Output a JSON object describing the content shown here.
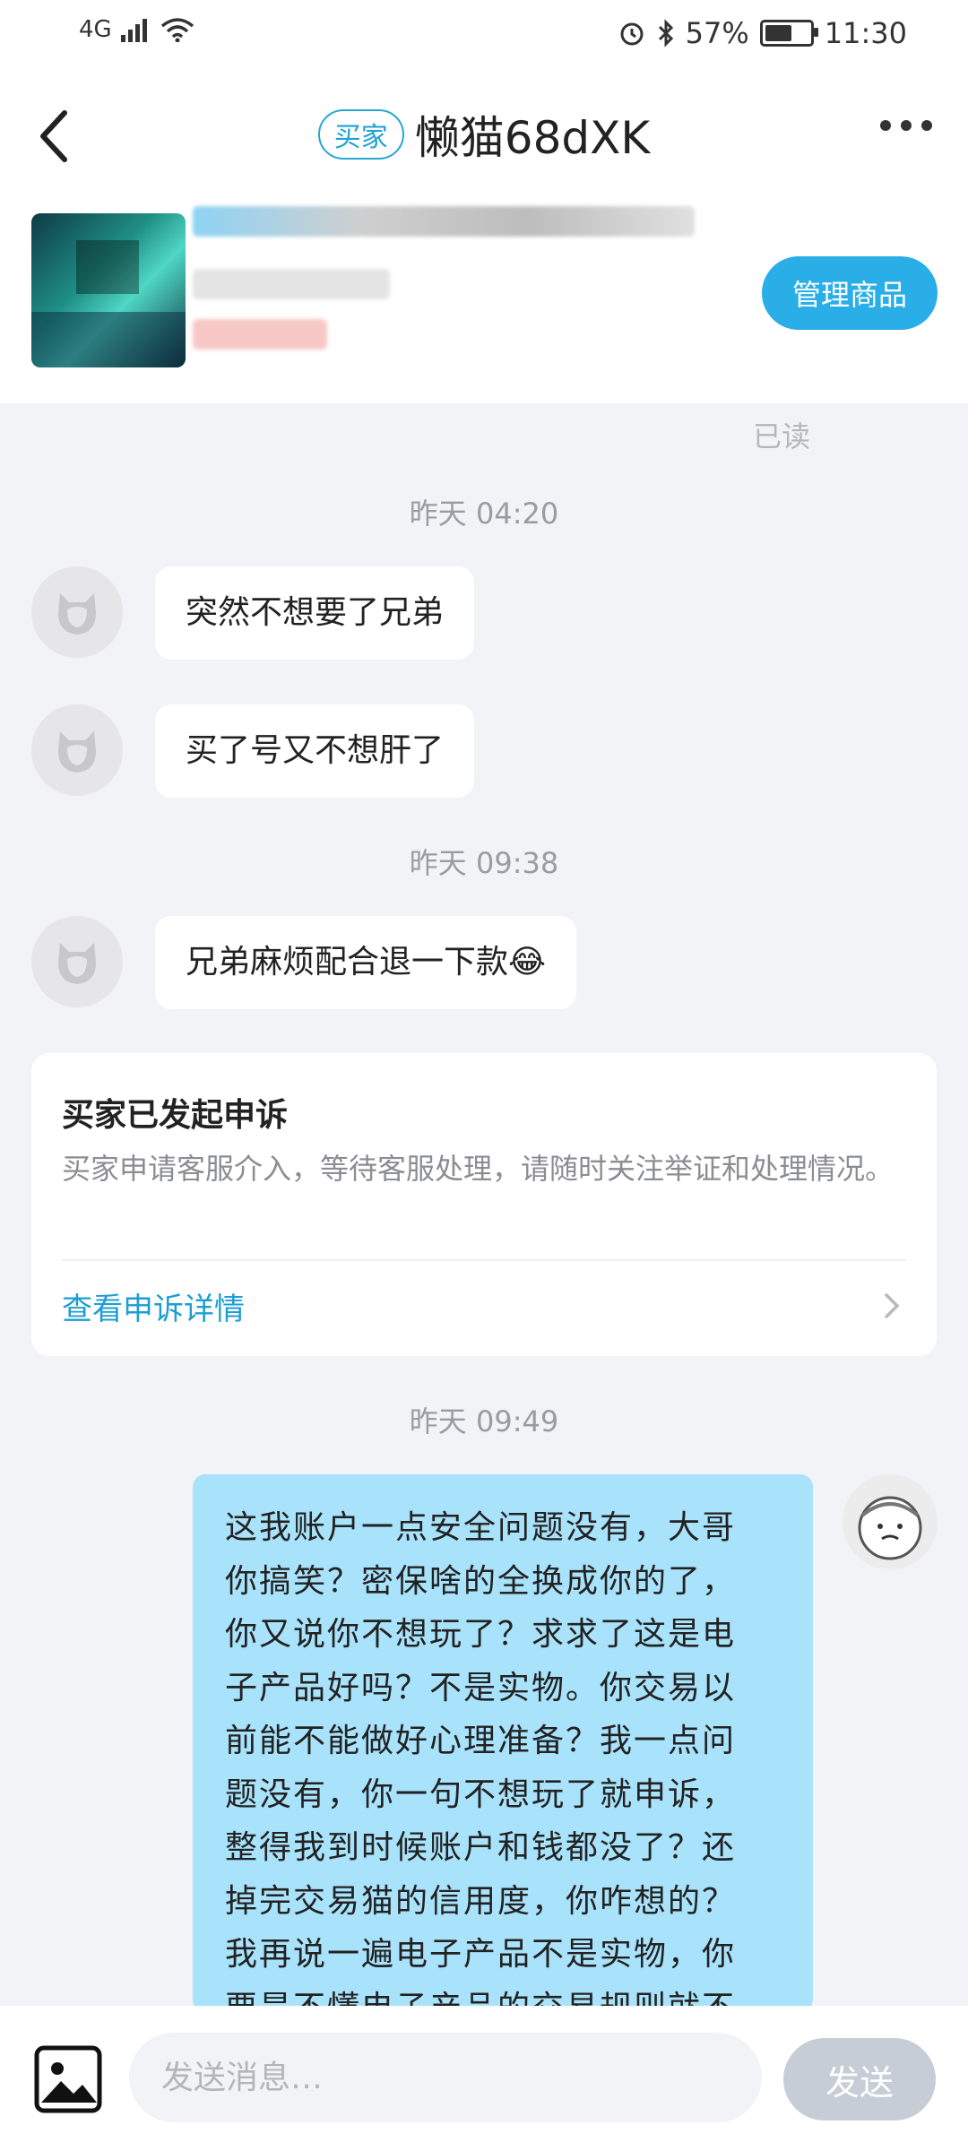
{
  "status_bar": {
    "network": "4G",
    "battery": "57%",
    "time": "11:30"
  },
  "header": {
    "badge": "买家",
    "title": "懒猫68dXK",
    "more_icon": "more-dots-icon"
  },
  "product": {
    "manage_button": "管理商品"
  },
  "chat": {
    "read_status": "已读",
    "times": [
      "昨天 04:20",
      "昨天 09:38",
      "昨天 09:49"
    ],
    "incoming": [
      "突然不想要了兄弟",
      "买了号又不想肝了",
      "兄弟麻烦配合退一下款😂"
    ],
    "appeal": {
      "title": "买家已发起申诉",
      "description": "买家申请客服介入，等待客服处理，请随时关注举证和处理情况。",
      "link": "查看申诉详情"
    },
    "outgoing_lines": [
      "这我账户一点安全问题没有，大哥",
      "你搞笑？密保啥的全换成你的了，",
      "你又说你不想玩了？求求了这是电",
      "子产品好吗？不是实物。你交易以",
      "前能不能做好心理准备？我一点问",
      "题没有，你一句不想玩了就申诉，",
      "整得我到时候账户和钱都没了？还",
      "掉完交易猫的信用度，你咋想的？",
      "我再说一遍电子产品不是实物，你",
      "要是不懂电子产品的交易规则就不"
    ]
  },
  "input_bar": {
    "placeholder": "发送消息…",
    "send": "发送"
  },
  "colors": {
    "accent": "#29aee8",
    "outgoing_bubble": "#a9e2fb",
    "background": "#f2f3f7"
  }
}
